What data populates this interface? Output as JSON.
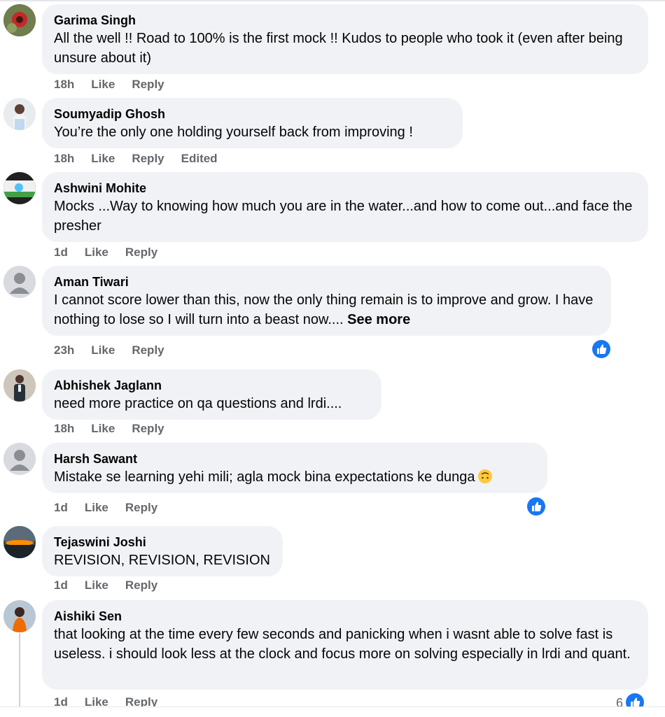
{
  "comments": [
    {
      "author": "Garima Singh",
      "text": "All the well !! Road to 100% is the first mock !! Kudos to people who took it (even after being unsure about it)",
      "time": "18h",
      "like": "Like",
      "reply": "Reply"
    },
    {
      "author": "Soumyadip Ghosh",
      "text": "You’re the only one holding yourself back from improving !",
      "time": "18h",
      "like": "Like",
      "reply": "Reply",
      "edited": "Edited"
    },
    {
      "author": "Ashwini Mohite",
      "text": "Mocks ...Way to knowing how much you are in the water...and how to come out...and face the presher",
      "time": "1d",
      "like": "Like",
      "reply": "Reply"
    },
    {
      "author": "Aman Tiwari",
      "text": "I cannot score lower than this, now the only thing remain is to improve and grow. I have nothing to lose so I will turn into a beast now....",
      "see_more": "See more",
      "time": "23h",
      "like": "Like",
      "reply": "Reply"
    },
    {
      "author": "Abhishek Jaglann",
      "text": "need more practice on qa questions and lrdi....",
      "time": "18h",
      "like": "Like",
      "reply": "Reply"
    },
    {
      "author": "Harsh Sawant",
      "text": "Mistake se learning yehi mili; agla mock bina expectations ke dunga",
      "time": "1d",
      "like": "Like",
      "reply": "Reply"
    },
    {
      "author": "Tejaswini Joshi",
      "text": "REVISION, REVISION, REVISION",
      "time": "1d",
      "like": "Like",
      "reply": "Reply"
    },
    {
      "author": "Aishiki Sen",
      "text": "that looking at the time every few seconds and panicking when i wasnt able to solve fast is useless. i should look less at the clock and focus more on solving especially in lrdi and quant.",
      "time": "1d",
      "like": "Like",
      "reply": "Reply",
      "reaction_count": "6"
    }
  ],
  "icons": {
    "like_badge": "thumbs-up-icon",
    "emoji": "upside-down-face-icon",
    "avatar_default": "default-avatar-icon"
  },
  "colors": {
    "bubble": "#f0f2f5",
    "meta": "#65676b",
    "like_blue": "#1877f2"
  }
}
